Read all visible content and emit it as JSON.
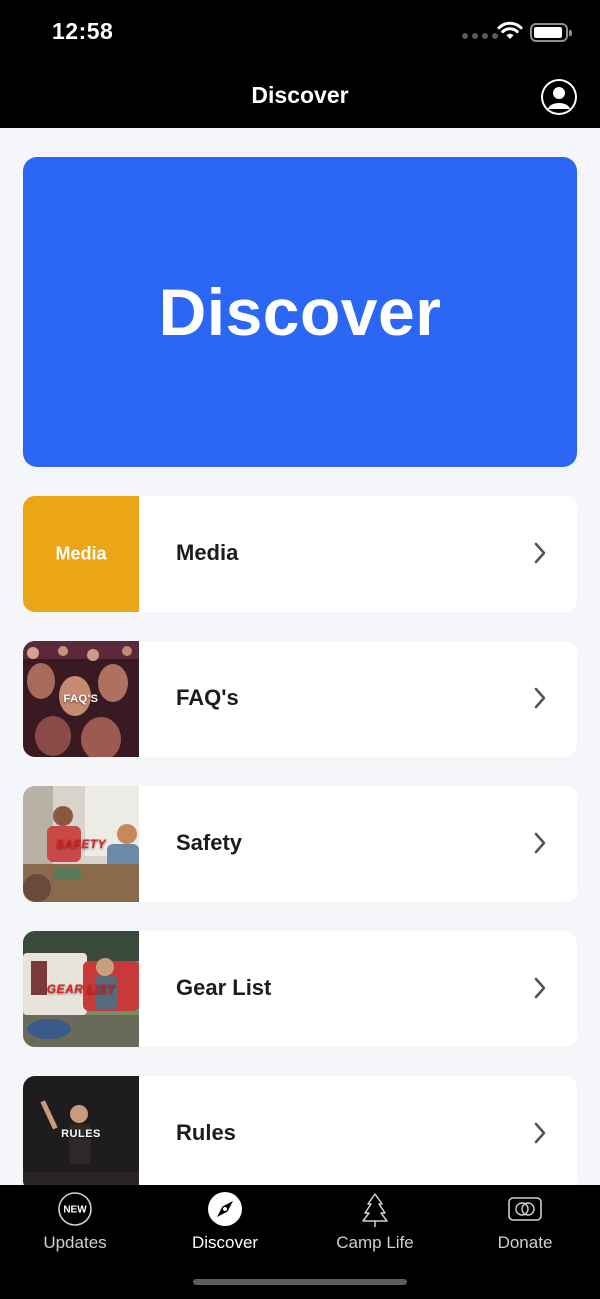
{
  "status_bar": {
    "time": "12:58"
  },
  "nav": {
    "title": "Discover"
  },
  "hero": {
    "title": "Discover"
  },
  "rows": [
    {
      "label": "Media",
      "thumb_text": "Media",
      "thumb_color": "#eaa615"
    },
    {
      "label": "FAQ's",
      "thumb_text": "FAQ'S"
    },
    {
      "label": "Safety",
      "thumb_text": "SAFETY"
    },
    {
      "label": "Gear List",
      "thumb_text": "GEAR LIST"
    },
    {
      "label": "Rules",
      "thumb_text": "RULES"
    }
  ],
  "tabs": [
    {
      "label": "Updates",
      "icon": "new-badge-icon",
      "badge": "NEW"
    },
    {
      "label": "Discover",
      "icon": "compass-icon",
      "active": true
    },
    {
      "label": "Camp Life",
      "icon": "tree-icon"
    },
    {
      "label": "Donate",
      "icon": "card-icon"
    }
  ],
  "colors": {
    "accent_blue": "#2b66f5",
    "background": "#f4f6fa",
    "bar": "#000000"
  }
}
